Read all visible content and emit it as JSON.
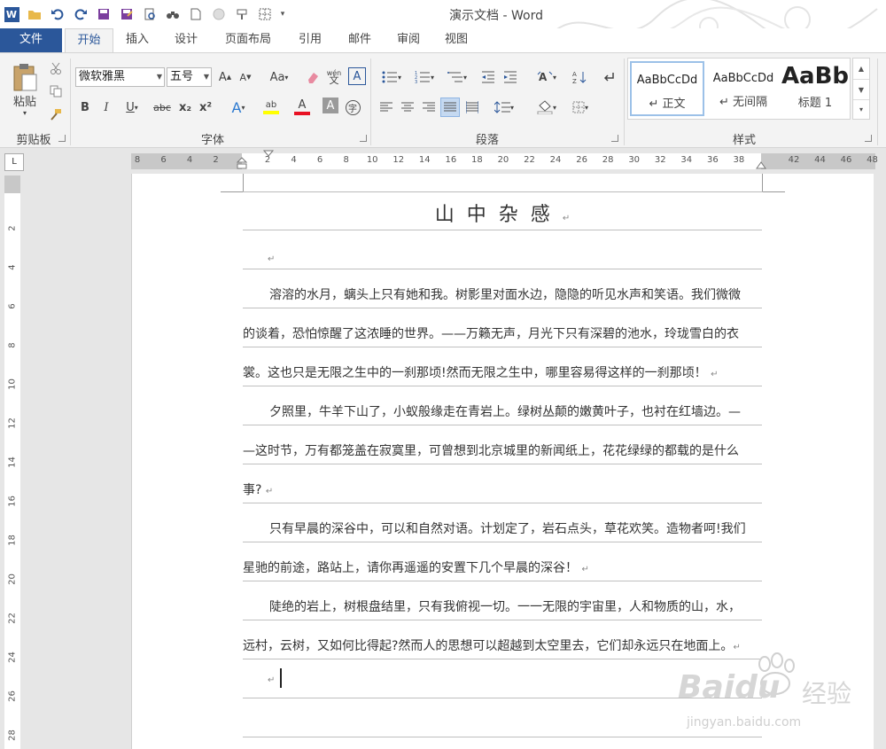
{
  "window": {
    "title": "演示文档 - Word"
  },
  "tabs": [
    {
      "label": "文件"
    },
    {
      "label": "开始"
    },
    {
      "label": "插入"
    },
    {
      "label": "设计"
    },
    {
      "label": "页面布局"
    },
    {
      "label": "引用"
    },
    {
      "label": "邮件"
    },
    {
      "label": "审阅"
    },
    {
      "label": "视图"
    }
  ],
  "ribbon": {
    "clipboard": {
      "paste_label": "粘贴",
      "group_label": "剪贴板"
    },
    "font": {
      "font_name": "微软雅黑",
      "font_size": "五号",
      "group_label": "字体",
      "grow": "A",
      "shrink": "A",
      "case": "Aa",
      "phonetic": "wén",
      "border_char": "A",
      "bold": "B",
      "italic": "I",
      "underline": "U",
      "strike": "abc",
      "sub": "x₂",
      "sup": "x²",
      "effect": "A",
      "highlight": "ab",
      "color": "A",
      "shade": "A",
      "enclose": "字"
    },
    "paragraph": {
      "group_label": "段落"
    },
    "styles": {
      "group_label": "样式",
      "items": [
        {
          "sample": "AaBbCcDd",
          "name": "↵ 正文"
        },
        {
          "sample": "AaBbCcDd",
          "name": "↵ 无间隔"
        },
        {
          "sample": "AaBb",
          "name": "标题 1"
        }
      ]
    }
  },
  "ruler": {
    "h_left": [
      "8",
      "6",
      "4",
      "2"
    ],
    "h_right": [
      "2",
      "4",
      "6",
      "8",
      "10",
      "12",
      "14",
      "16",
      "18",
      "20",
      "22",
      "24",
      "26",
      "28",
      "30",
      "32",
      "34",
      "36",
      "38"
    ],
    "h_far": [
      "42",
      "44",
      "46",
      "48"
    ],
    "v": [
      "2",
      "4",
      "6",
      "8",
      "10",
      "12",
      "14",
      "16",
      "18",
      "20",
      "22",
      "24",
      "26",
      "28"
    ],
    "corner": "L"
  },
  "document": {
    "title": "山中杂感",
    "para_mark": "↵",
    "lines": [
      "溶溶的水月，螭头上只有她和我。树影里对面水边，隐隐的听见水声和笑语。我们微微",
      "的谈着，恐怕惊醒了这浓睡的世界。——万籁无声，月光下只有深碧的池水，玲珑雪白的衣",
      "裳。这也只是无限之生中的一刹那顷!然而无限之生中，哪里容易得这样的一刹那顷！",
      "夕照里，牛羊下山了，小蚁般缘走在青岩上。绿树丛颠的嫩黄叶子，也衬在红墙边。—",
      "—这时节，万有都笼盖在寂寞里，可曾想到北京城里的新闻纸上，花花绿绿的都载的是什么",
      "事?",
      "只有早晨的深谷中，可以和自然对语。计划定了，岩石点头，草花欢笑。造物者呵!我们",
      "星驰的前途，路站上，请你再遥遥的安置下几个早晨的深谷！",
      "陡绝的岩上，树根盘结里，只有我俯视一切。一一无限的宇宙里，人和物质的山，水，",
      "远村，云树，又如何比得起?然而人的思想可以超越到太空里去，它们却永远只在地面上。"
    ]
  },
  "watermark": {
    "brand": "Baidu",
    "cn": "经验",
    "url": "jingyan.baidu.com"
  }
}
